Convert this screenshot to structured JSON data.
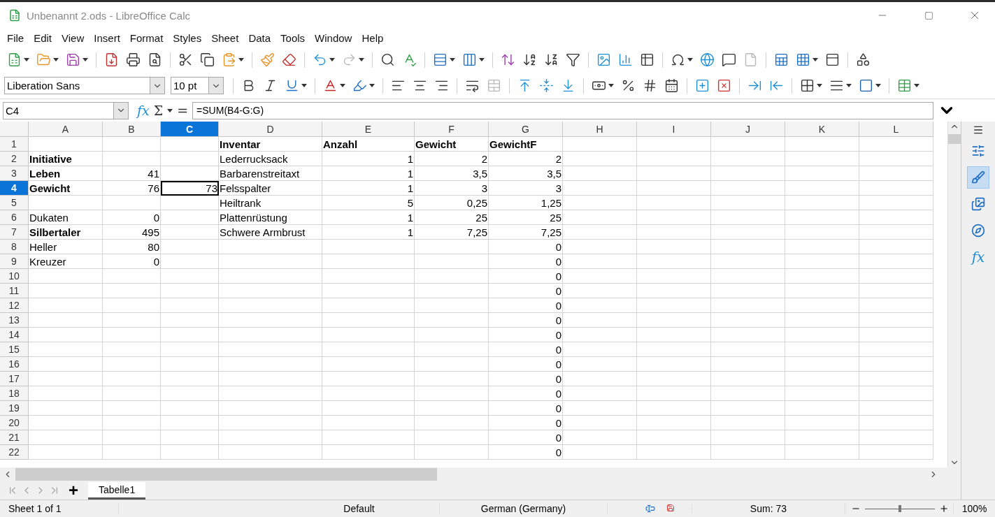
{
  "window": {
    "title": "Unbenannt 2.ods - LibreOffice Calc"
  },
  "menu": [
    "File",
    "Edit",
    "View",
    "Insert",
    "Format",
    "Styles",
    "Sheet",
    "Data",
    "Tools",
    "Window",
    "Help"
  ],
  "toolbar_1": [
    {
      "kind": "new",
      "dropdown": true,
      "disabled": false
    },
    {
      "kind": "open",
      "dropdown": true,
      "disabled": false
    },
    {
      "kind": "save",
      "dropdown": true,
      "disabled": false
    },
    {
      "kind": "separator"
    },
    {
      "kind": "pdf",
      "dropdown": false,
      "disabled": false
    },
    {
      "kind": "print",
      "dropdown": false,
      "disabled": false
    },
    {
      "kind": "preview",
      "dropdown": false,
      "disabled": false
    },
    {
      "kind": "separator"
    },
    {
      "kind": "cut",
      "dropdown": false,
      "disabled": false
    },
    {
      "kind": "copy",
      "dropdown": false,
      "disabled": false
    },
    {
      "kind": "paste",
      "dropdown": true,
      "disabled": false
    },
    {
      "kind": "separator"
    },
    {
      "kind": "clone",
      "dropdown": false,
      "disabled": false
    },
    {
      "kind": "clear",
      "dropdown": false,
      "disabled": false
    },
    {
      "kind": "separator"
    },
    {
      "kind": "undo",
      "dropdown": true,
      "disabled": false
    },
    {
      "kind": "redo",
      "dropdown": true,
      "disabled": true
    },
    {
      "kind": "separator"
    },
    {
      "kind": "find",
      "dropdown": false,
      "disabled": false
    },
    {
      "kind": "spell",
      "dropdown": false,
      "disabled": false
    },
    {
      "kind": "separator"
    },
    {
      "kind": "row",
      "dropdown": true,
      "disabled": false
    },
    {
      "kind": "column",
      "dropdown": true,
      "disabled": false
    },
    {
      "kind": "separator"
    },
    {
      "kind": "sort",
      "dropdown": false,
      "disabled": false
    },
    {
      "kind": "sortasc",
      "dropdown": false,
      "disabled": false
    },
    {
      "kind": "sortdesc",
      "dropdown": false,
      "disabled": false
    },
    {
      "kind": "filter",
      "dropdown": false,
      "disabled": false
    },
    {
      "kind": "separator"
    },
    {
      "kind": "image",
      "dropdown": false,
      "disabled": false
    },
    {
      "kind": "chart",
      "dropdown": false,
      "disabled": false
    },
    {
      "kind": "pivot",
      "dropdown": false,
      "disabled": false
    },
    {
      "kind": "separator"
    },
    {
      "kind": "special",
      "dropdown": true,
      "disabled": false
    },
    {
      "kind": "hyperlink",
      "dropdown": false,
      "disabled": false
    },
    {
      "kind": "comment",
      "dropdown": false,
      "disabled": false
    },
    {
      "kind": "headerfooter",
      "dropdown": false,
      "disabled": true
    },
    {
      "kind": "separator"
    },
    {
      "kind": "printarea",
      "dropdown": false,
      "disabled": false
    },
    {
      "kind": "freeze",
      "dropdown": true,
      "disabled": false
    },
    {
      "kind": "split",
      "dropdown": false,
      "disabled": false
    },
    {
      "kind": "separator"
    },
    {
      "kind": "shapes",
      "dropdown": false,
      "disabled": false
    }
  ],
  "font": {
    "value": "Liberation Sans"
  },
  "font_size": {
    "value": "10 pt"
  },
  "toolbar_2": [
    {
      "kind": "separator"
    },
    {
      "kind": "bold",
      "dropdown": false,
      "disabled": false
    },
    {
      "kind": "italic",
      "dropdown": false,
      "disabled": false
    },
    {
      "kind": "underline",
      "dropdown": true,
      "disabled": false
    },
    {
      "kind": "separator"
    },
    {
      "kind": "fontcolor",
      "dropdown": true,
      "disabled": false
    },
    {
      "kind": "highlight",
      "dropdown": true,
      "disabled": false
    },
    {
      "kind": "separator"
    },
    {
      "kind": "alignleft",
      "dropdown": false,
      "disabled": false
    },
    {
      "kind": "aligncenter",
      "dropdown": false,
      "disabled": false
    },
    {
      "kind": "alignright",
      "dropdown": false,
      "disabled": false
    },
    {
      "kind": "separator"
    },
    {
      "kind": "wrap",
      "dropdown": false,
      "disabled": false
    },
    {
      "kind": "merge",
      "dropdown": false,
      "disabled": true
    },
    {
      "kind": "separator"
    },
    {
      "kind": "top",
      "dropdown": false,
      "disabled": false
    },
    {
      "kind": "vcenter",
      "dropdown": false,
      "disabled": false
    },
    {
      "kind": "bottom",
      "dropdown": false,
      "disabled": false
    },
    {
      "kind": "separator"
    },
    {
      "kind": "currency",
      "dropdown": true,
      "disabled": false
    },
    {
      "kind": "percent",
      "dropdown": false,
      "disabled": false
    },
    {
      "kind": "number",
      "dropdown": false,
      "disabled": false
    },
    {
      "kind": "date",
      "dropdown": false,
      "disabled": false
    },
    {
      "kind": "separator"
    },
    {
      "kind": "adddecimal",
      "dropdown": false,
      "disabled": false
    },
    {
      "kind": "deletedecimal",
      "dropdown": false,
      "disabled": false
    },
    {
      "kind": "separator"
    },
    {
      "kind": "indent",
      "dropdown": false,
      "disabled": false
    },
    {
      "kind": "outdent",
      "dropdown": false,
      "disabled": false
    },
    {
      "kind": "separator"
    },
    {
      "kind": "borders",
      "dropdown": true,
      "disabled": false
    },
    {
      "kind": "borderstyle",
      "dropdown": true,
      "disabled": false
    },
    {
      "kind": "bordercolor",
      "dropdown": true,
      "disabled": false
    },
    {
      "kind": "separator"
    },
    {
      "kind": "conditional",
      "dropdown": true,
      "disabled": false
    }
  ],
  "formula_bar": {
    "name_box": "C4",
    "function_wizard": "fx",
    "sum": "Σ",
    "equals": "=",
    "formula": "=SUM(B4-G:G)"
  },
  "sheet": {
    "columns": [
      {
        "label": "A",
        "selected": false
      },
      {
        "label": "B",
        "selected": false
      },
      {
        "label": "C",
        "selected": true
      },
      {
        "label": "D",
        "selected": false
      },
      {
        "label": "E",
        "selected": false
      },
      {
        "label": "F",
        "selected": false
      },
      {
        "label": "G",
        "selected": false
      },
      {
        "label": "H",
        "selected": false
      },
      {
        "label": "I",
        "selected": false
      },
      {
        "label": "J",
        "selected": false
      },
      {
        "label": "K",
        "selected": false
      },
      {
        "label": "L",
        "selected": false
      }
    ],
    "rows": [
      {
        "label": "1",
        "selected": false,
        "cells": [
          null,
          null,
          null,
          {
            "text": "Inventar",
            "bold": true,
            "kind": "text"
          },
          {
            "text": "Anzahl",
            "bold": true,
            "kind": "text"
          },
          {
            "text": "Gewicht",
            "bold": true,
            "kind": "text"
          },
          {
            "text": "GewichtF",
            "bold": true,
            "kind": "text"
          },
          null,
          null,
          null,
          null,
          null
        ]
      },
      {
        "label": "2",
        "selected": false,
        "cells": [
          {
            "text": "Initiative",
            "bold": true,
            "kind": "text"
          },
          null,
          null,
          {
            "text": "Lederrucksack",
            "bold": false,
            "kind": "text"
          },
          {
            "text": "1",
            "bold": false,
            "kind": "number"
          },
          {
            "text": "2",
            "bold": false,
            "kind": "number"
          },
          {
            "text": "2",
            "bold": false,
            "kind": "number"
          },
          null,
          null,
          null,
          null,
          null
        ]
      },
      {
        "label": "3",
        "selected": false,
        "cells": [
          {
            "text": "Leben",
            "bold": true,
            "kind": "text"
          },
          {
            "text": "41",
            "bold": false,
            "kind": "number"
          },
          null,
          {
            "text": "Barbarenstreitaxt",
            "bold": false,
            "kind": "text"
          },
          {
            "text": "1",
            "bold": false,
            "kind": "number"
          },
          {
            "text": "3,5",
            "bold": false,
            "kind": "number"
          },
          {
            "text": "3,5",
            "bold": false,
            "kind": "number"
          },
          null,
          null,
          null,
          null,
          null
        ]
      },
      {
        "label": "4",
        "selected": true,
        "cells": [
          {
            "text": "Gewicht",
            "bold": true,
            "kind": "text"
          },
          {
            "text": "76",
            "bold": false,
            "kind": "number"
          },
          {
            "text": "73",
            "bold": false,
            "kind": "number"
          },
          {
            "text": "Felsspalter",
            "bold": false,
            "kind": "text"
          },
          {
            "text": "1",
            "bold": false,
            "kind": "number"
          },
          {
            "text": "3",
            "bold": false,
            "kind": "number"
          },
          {
            "text": "3",
            "bold": false,
            "kind": "number"
          },
          null,
          null,
          null,
          null,
          null
        ]
      },
      {
        "label": "5",
        "selected": false,
        "cells": [
          null,
          null,
          null,
          {
            "text": "Heiltrank",
            "bold": false,
            "kind": "text"
          },
          {
            "text": "5",
            "bold": false,
            "kind": "number"
          },
          {
            "text": "0,25",
            "bold": false,
            "kind": "number"
          },
          {
            "text": "1,25",
            "bold": false,
            "kind": "number"
          },
          null,
          null,
          null,
          null,
          null
        ]
      },
      {
        "label": "6",
        "selected": false,
        "cells": [
          {
            "text": "Dukaten",
            "bold": false,
            "kind": "text"
          },
          {
            "text": "0",
            "bold": false,
            "kind": "number"
          },
          null,
          {
            "text": "Plattenrüstung",
            "bold": false,
            "kind": "text"
          },
          {
            "text": "1",
            "bold": false,
            "kind": "number"
          },
          {
            "text": "25",
            "bold": false,
            "kind": "number"
          },
          {
            "text": "25",
            "bold": false,
            "kind": "number"
          },
          null,
          null,
          null,
          null,
          null
        ]
      },
      {
        "label": "7",
        "selected": false,
        "cells": [
          {
            "text": "Silbertaler",
            "bold": true,
            "kind": "text"
          },
          {
            "text": "495",
            "bold": false,
            "kind": "number"
          },
          null,
          {
            "text": "Schwere Armbrust",
            "bold": false,
            "kind": "text"
          },
          {
            "text": "1",
            "bold": false,
            "kind": "number"
          },
          {
            "text": "7,25",
            "bold": false,
            "kind": "number"
          },
          {
            "text": "7,25",
            "bold": false,
            "kind": "number"
          },
          null,
          null,
          null,
          null,
          null
        ]
      },
      {
        "label": "8",
        "selected": false,
        "cells": [
          {
            "text": "Heller",
            "bold": false,
            "kind": "text"
          },
          {
            "text": "80",
            "bold": false,
            "kind": "number"
          },
          null,
          null,
          null,
          null,
          {
            "text": "0",
            "bold": false,
            "kind": "number"
          },
          null,
          null,
          null,
          null,
          null
        ]
      },
      {
        "label": "9",
        "selected": false,
        "cells": [
          {
            "text": "Kreuzer",
            "bold": false,
            "kind": "text"
          },
          {
            "text": "0",
            "bold": false,
            "kind": "number"
          },
          null,
          null,
          null,
          null,
          {
            "text": "0",
            "bold": false,
            "kind": "number"
          },
          null,
          null,
          null,
          null,
          null
        ]
      },
      {
        "label": "10",
        "selected": false,
        "cells": [
          null,
          null,
          null,
          null,
          null,
          null,
          {
            "text": "0",
            "bold": false,
            "kind": "number"
          },
          null,
          null,
          null,
          null,
          null
        ]
      },
      {
        "label": "11",
        "selected": false,
        "cells": [
          null,
          null,
          null,
          null,
          null,
          null,
          {
            "text": "0",
            "bold": false,
            "kind": "number"
          },
          null,
          null,
          null,
          null,
          null
        ]
      },
      {
        "label": "12",
        "selected": false,
        "cells": [
          null,
          null,
          null,
          null,
          null,
          null,
          {
            "text": "0",
            "bold": false,
            "kind": "number"
          },
          null,
          null,
          null,
          null,
          null
        ]
      },
      {
        "label": "13",
        "selected": false,
        "cells": [
          null,
          null,
          null,
          null,
          null,
          null,
          {
            "text": "0",
            "bold": false,
            "kind": "number"
          },
          null,
          null,
          null,
          null,
          null
        ]
      },
      {
        "label": "14",
        "selected": false,
        "cells": [
          null,
          null,
          null,
          null,
          null,
          null,
          {
            "text": "0",
            "bold": false,
            "kind": "number"
          },
          null,
          null,
          null,
          null,
          null
        ]
      },
      {
        "label": "15",
        "selected": false,
        "cells": [
          null,
          null,
          null,
          null,
          null,
          null,
          {
            "text": "0",
            "bold": false,
            "kind": "number"
          },
          null,
          null,
          null,
          null,
          null
        ]
      },
      {
        "label": "16",
        "selected": false,
        "cells": [
          null,
          null,
          null,
          null,
          null,
          null,
          {
            "text": "0",
            "bold": false,
            "kind": "number"
          },
          null,
          null,
          null,
          null,
          null
        ]
      },
      {
        "label": "17",
        "selected": false,
        "cells": [
          null,
          null,
          null,
          null,
          null,
          null,
          {
            "text": "0",
            "bold": false,
            "kind": "number"
          },
          null,
          null,
          null,
          null,
          null
        ]
      },
      {
        "label": "18",
        "selected": false,
        "cells": [
          null,
          null,
          null,
          null,
          null,
          null,
          {
            "text": "0",
            "bold": false,
            "kind": "number"
          },
          null,
          null,
          null,
          null,
          null
        ]
      },
      {
        "label": "19",
        "selected": false,
        "cells": [
          null,
          null,
          null,
          null,
          null,
          null,
          {
            "text": "0",
            "bold": false,
            "kind": "number"
          },
          null,
          null,
          null,
          null,
          null
        ]
      },
      {
        "label": "20",
        "selected": false,
        "cells": [
          null,
          null,
          null,
          null,
          null,
          null,
          {
            "text": "0",
            "bold": false,
            "kind": "number"
          },
          null,
          null,
          null,
          null,
          null
        ]
      },
      {
        "label": "21",
        "selected": false,
        "cells": [
          null,
          null,
          null,
          null,
          null,
          null,
          {
            "text": "0",
            "bold": false,
            "kind": "number"
          },
          null,
          null,
          null,
          null,
          null
        ]
      },
      {
        "label": "22",
        "selected": false,
        "cells": [
          null,
          null,
          null,
          null,
          null,
          null,
          {
            "text": "0",
            "bold": false,
            "kind": "number"
          },
          null,
          null,
          null,
          null,
          null
        ]
      }
    ]
  },
  "sheet_tabs": {
    "add": "+",
    "tabs": [
      {
        "label": "Tabelle1",
        "selected": true
      }
    ]
  },
  "sidebar": [
    {
      "kind": "properties",
      "selected": false
    },
    {
      "kind": "styles",
      "selected": true
    },
    {
      "kind": "gallery",
      "selected": false
    },
    {
      "kind": "navigator",
      "selected": false
    },
    {
      "kind": "functions",
      "selected": false,
      "label": "fx"
    }
  ],
  "status_bar": {
    "sheet": "Sheet 1 of 1",
    "page_style": "Default",
    "language": "German (Germany)",
    "sum": "Sum: 73",
    "zoom": {
      "level": 0.5,
      "text": "100%"
    }
  }
}
